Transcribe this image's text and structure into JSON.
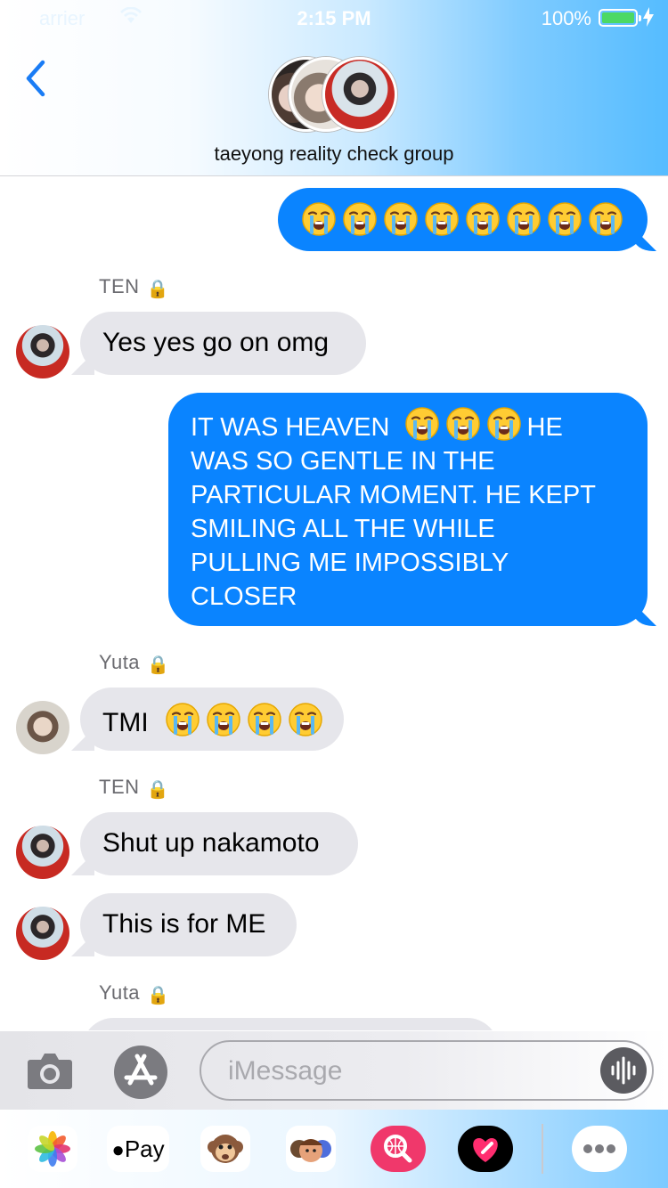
{
  "status_bar": {
    "carrier": "arrier",
    "time": "2:15 PM",
    "battery_percent": "100%"
  },
  "header": {
    "group_name": "taeyong reality check group"
  },
  "messages": [
    {
      "type": "outgoing",
      "emoji_count": 8
    },
    {
      "type": "sender",
      "name": "TEN"
    },
    {
      "type": "incoming",
      "text": "Yes yes go on omg"
    },
    {
      "type": "outgoing",
      "lines": [
        "IT WAS HEAVEN",
        "HE",
        "WAS SO GENTLE IN THE",
        "PARTICULAR MOMENT. HE KEPT",
        "SMILING ALL THE WHILE",
        "PULLING ME IMPOSSIBLY",
        "CLOSER"
      ]
    },
    {
      "type": "sender",
      "name": "Yuta"
    },
    {
      "type": "incoming",
      "text": "TMI"
    },
    {
      "type": "sender",
      "name": "TEN"
    },
    {
      "type": "incoming",
      "text": "Shut up nakamoto"
    },
    {
      "type": "incoming",
      "text": "This is for ME"
    },
    {
      "type": "sender",
      "name": "Yuta"
    }
  ],
  "compose": {
    "placeholder": "iMessage"
  },
  "app_drawer": {
    "apple_pay_label": "Pay"
  },
  "colors": {
    "outgoing_bubble": "#0a84ff",
    "incoming_bubble": "#e6e6eb",
    "link_blue": "#1a7cf5"
  },
  "icons": [
    "lock-icon",
    "sob-emoji",
    "camera-icon",
    "app-store-icon",
    "audio-waveform-icon",
    "photos-app-icon",
    "apple-pay-icon",
    "monkey-emoji-icon",
    "memoji-icon",
    "image-search-icon",
    "heart-app-icon",
    "more-apps-icon"
  ]
}
